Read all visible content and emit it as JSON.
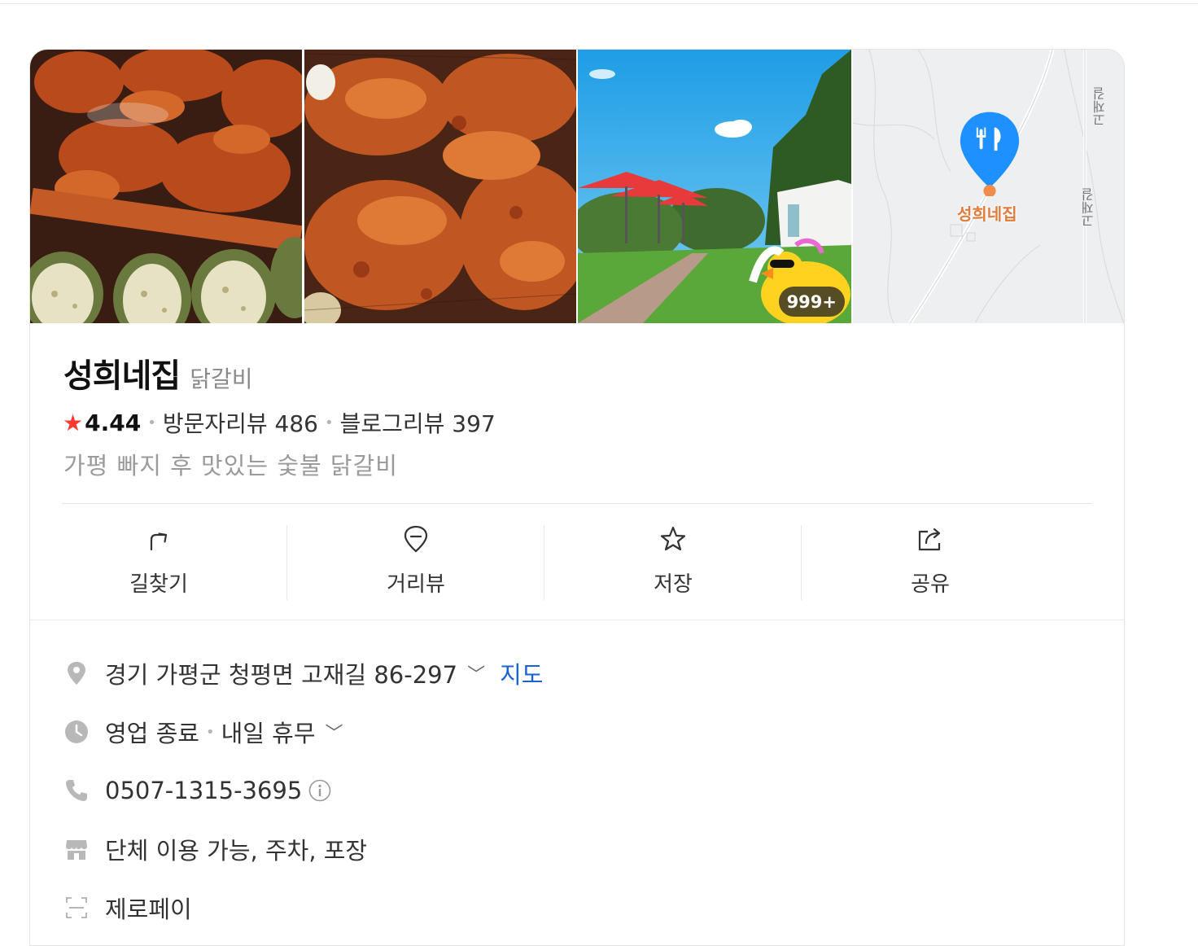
{
  "gallery": {
    "photo_count_badge": "999+",
    "map_pin_label": "성희네집",
    "map_road_label_1": "고재길",
    "map_road_label_2": "고재길"
  },
  "place": {
    "name": "성희네집",
    "category": "닭갈비",
    "rating": "4.44",
    "visitor_reviews": "방문자리뷰 486",
    "blog_reviews": "블로그리뷰 397",
    "description": "가평 빠지 후 맛있는 숯불 닭갈비"
  },
  "actions": {
    "directions": "길찾기",
    "street_view": "거리뷰",
    "save": "저장",
    "share": "공유"
  },
  "info": {
    "address": "경기 가평군 청평면 고재길 86-297",
    "map_link": "지도",
    "hours_status": "영업 종료",
    "hours_next": "내일 휴무",
    "phone": "0507-1315-3695",
    "amenities": "단체 이용 가능, 주차, 포장",
    "payment": "제로페이"
  },
  "colors": {
    "star": "#ff3b30",
    "link": "#1a62d6",
    "pin": "#1e90ff",
    "map_label": "#e07b3a"
  }
}
